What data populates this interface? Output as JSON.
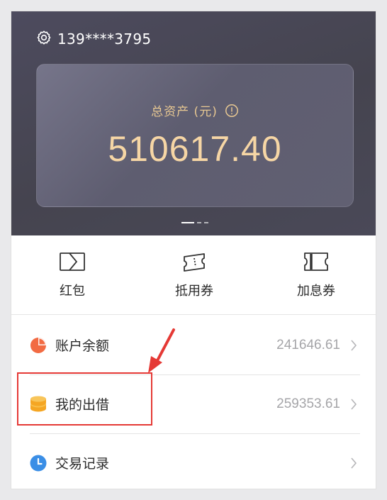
{
  "header": {
    "user_phone": "139****3795",
    "settings_icon": "gear-icon"
  },
  "asset_card": {
    "label": "总资产 (元)",
    "value": "510617.40",
    "info_icon": "info-icon"
  },
  "quick_actions": [
    {
      "label": "红包",
      "icon": "red-packet-icon"
    },
    {
      "label": "抵用券",
      "icon": "voucher-icon"
    },
    {
      "label": "加息券",
      "icon": "interest-coupon-icon"
    }
  ],
  "list": [
    {
      "label": "账户余额",
      "value": "241646.61",
      "icon": "pie-chart-icon",
      "color": "#f26b43"
    },
    {
      "label": "我的出借",
      "value": "259353.61",
      "icon": "coin-stack-icon",
      "color": "#f5a623"
    },
    {
      "label": "交易记录",
      "value": "",
      "icon": "clock-icon",
      "color": "#3a8ee6"
    }
  ],
  "colors": {
    "header_bg": "#4a4958",
    "gold_text": "#f6d6a5",
    "annotation_red": "#e53935"
  }
}
